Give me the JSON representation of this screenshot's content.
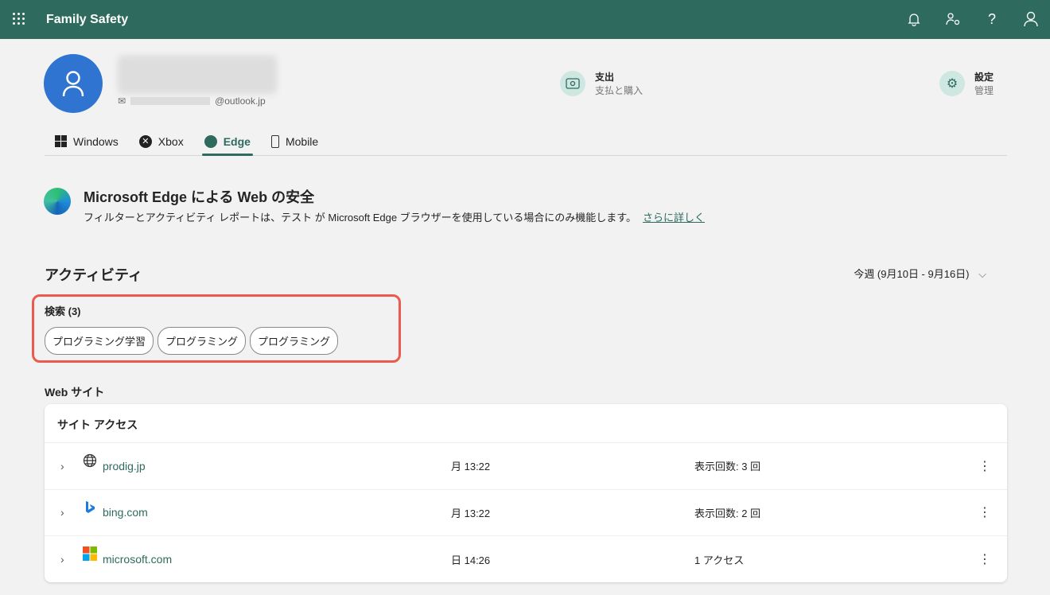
{
  "header": {
    "app_title": "Family Safety"
  },
  "profile": {
    "email_domain": "@outlook.jp"
  },
  "quick_actions": [
    {
      "title": "支出",
      "subtitle": "支払と購入"
    },
    {
      "title": "設定",
      "subtitle": "管理"
    }
  ],
  "tabs": [
    {
      "label": "Windows"
    },
    {
      "label": "Xbox"
    },
    {
      "label": "Edge"
    },
    {
      "label": "Mobile"
    }
  ],
  "edge_info": {
    "title": "Microsoft Edge による Web の安全",
    "description": "フィルターとアクティビティ レポートは、テスト が Microsoft Edge ブラウザーを使用している場合にのみ機能します。",
    "link": "さらに詳しく"
  },
  "activity": {
    "title": "アクティビティ",
    "range": "今週 (9月10日 - 9月16日)"
  },
  "searches": {
    "title": "検索 (3)",
    "items": [
      "プログラミング学習",
      "プログラミング",
      "プログラミング"
    ]
  },
  "websites": {
    "title": "Web サイト",
    "card_title": "サイト アクセス",
    "rows": [
      {
        "site": "prodig.jp",
        "time": "月 13:22",
        "count": "表示回数: 3 回"
      },
      {
        "site": "bing.com",
        "time": "月 13:22",
        "count": "表示回数: 2 回"
      },
      {
        "site": "microsoft.com",
        "time": "日 14:26",
        "count": "1 アクセス"
      }
    ]
  }
}
